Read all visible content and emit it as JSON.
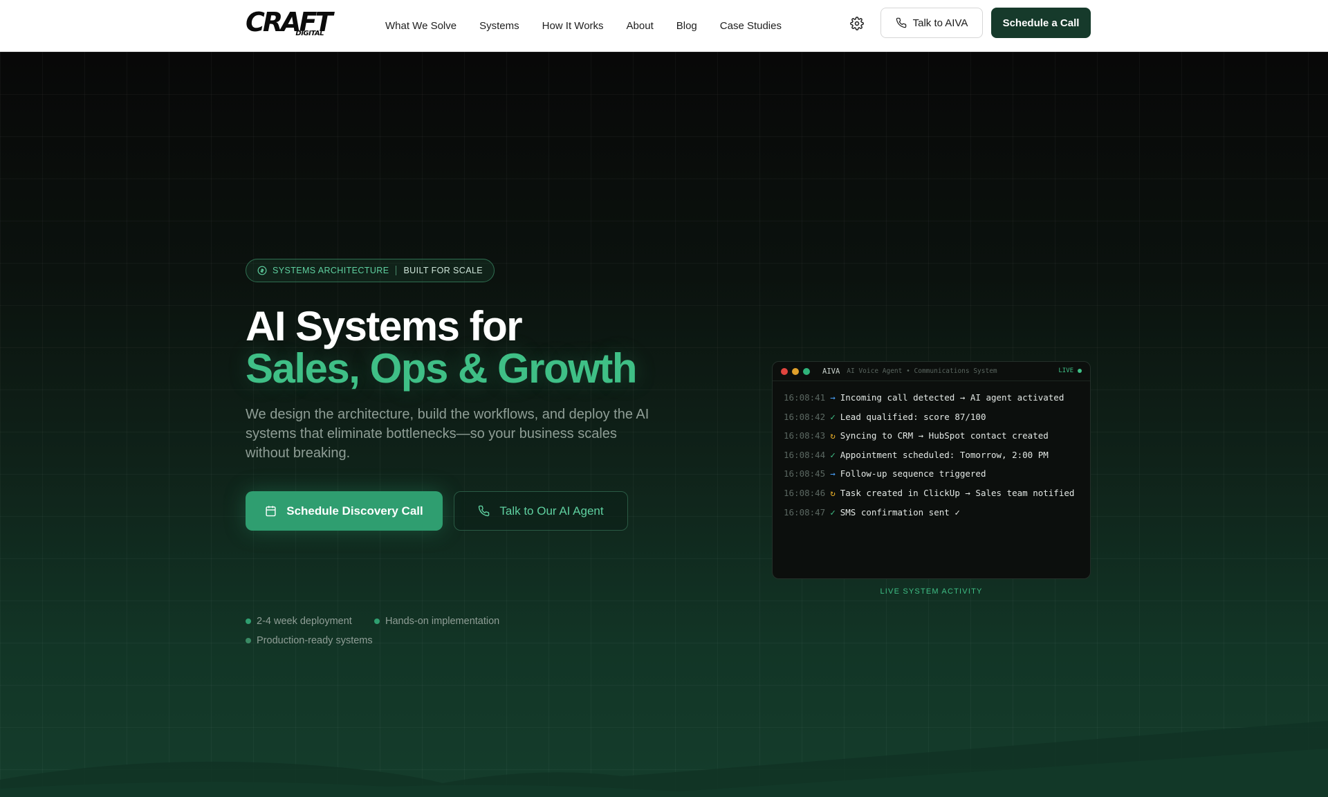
{
  "header": {
    "logo_main": "CRAFT",
    "logo_sub": "DIGITAL",
    "nav": [
      "What We Solve",
      "Systems",
      "How It Works",
      "About",
      "Blog",
      "Case Studies"
    ],
    "talk_label": "Talk to AIVA",
    "schedule_label": "Schedule a Call"
  },
  "hero": {
    "badge_primary": "SYSTEMS ARCHITECTURE",
    "badge_secondary": "BUILT FOR SCALE",
    "title_line1": "AI Systems for",
    "title_line2": "Sales, Ops & Growth",
    "subtitle": "We design the architecture, build the workflows, and deploy the AI systems that eliminate bottlenecks—so your business scales without breaking.",
    "cta_primary": "Schedule Discovery Call",
    "cta_secondary": "Talk to Our AI Agent",
    "features": [
      "2-4 week deployment",
      "Hands-on implementation",
      "Production-ready systems"
    ]
  },
  "terminal": {
    "title": "AIVA",
    "subtitle": "AI Voice Agent • Communications System",
    "live_label": "LIVE",
    "logs": [
      {
        "time": "16:08:41",
        "symbol": "→",
        "symbol_color": "#4aa3ff",
        "text": "Incoming call detected → AI agent activated"
      },
      {
        "time": "16:08:42",
        "symbol": "✓",
        "symbol_color": "#3fbf86",
        "text": "Lead qualified: score 87/100"
      },
      {
        "time": "16:08:43",
        "symbol": "↻",
        "symbol_color": "#f0b429",
        "text": "Syncing to CRM → HubSpot contact created"
      },
      {
        "time": "16:08:44",
        "symbol": "✓",
        "symbol_color": "#3fbf86",
        "text": "Appointment scheduled: Tomorrow, 2:00 PM"
      },
      {
        "time": "16:08:45",
        "symbol": "→",
        "symbol_color": "#4aa3ff",
        "text": "Follow-up sequence triggered"
      },
      {
        "time": "16:08:46",
        "symbol": "↻",
        "symbol_color": "#f0b429",
        "text": "Task created in ClickUp → Sales team notified"
      },
      {
        "time": "16:08:47",
        "symbol": "✓",
        "symbol_color": "#3fbf86",
        "text": "SMS confirmation sent ✓"
      }
    ],
    "caption": "LIVE SYSTEM ACTIVITY"
  },
  "colors": {
    "accent": "#3fbf86",
    "primary_button": "#2f9e70",
    "header_cta": "#163a2b"
  }
}
